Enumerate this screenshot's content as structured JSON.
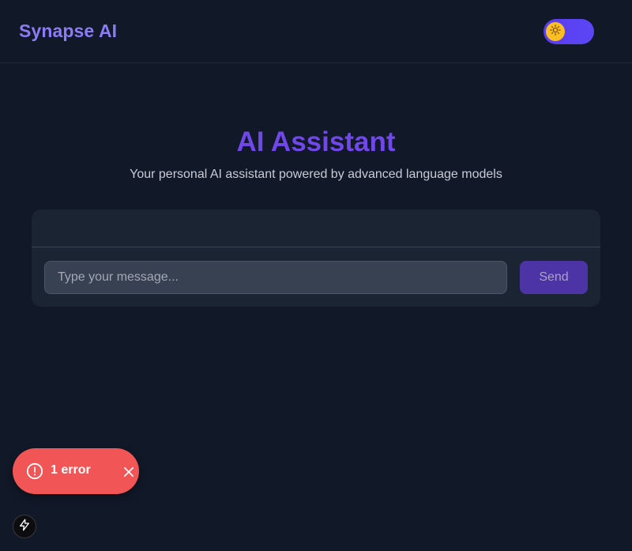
{
  "header": {
    "brand": "Synapse AI",
    "theme_toggle_icon": "sun-icon"
  },
  "hero": {
    "title": "AI Assistant",
    "subtitle": "Your personal AI assistant powered by advanced language models"
  },
  "chat": {
    "input_placeholder": "Type your message...",
    "input_value": "",
    "send_label": "Send"
  },
  "error_toast": {
    "text": "1 error",
    "icon": "alert-circle-icon",
    "close_icon": "close-icon"
  },
  "dev_badge": {
    "icon": "lightning-icon"
  },
  "colors": {
    "background": "#111827",
    "brand": "#8b7cf6",
    "title": "#7047e8",
    "toggle": "#5b3df0",
    "toggle_knob": "#fbbf24",
    "send_button": "#4c34a6",
    "error_toast": "#f25555"
  }
}
